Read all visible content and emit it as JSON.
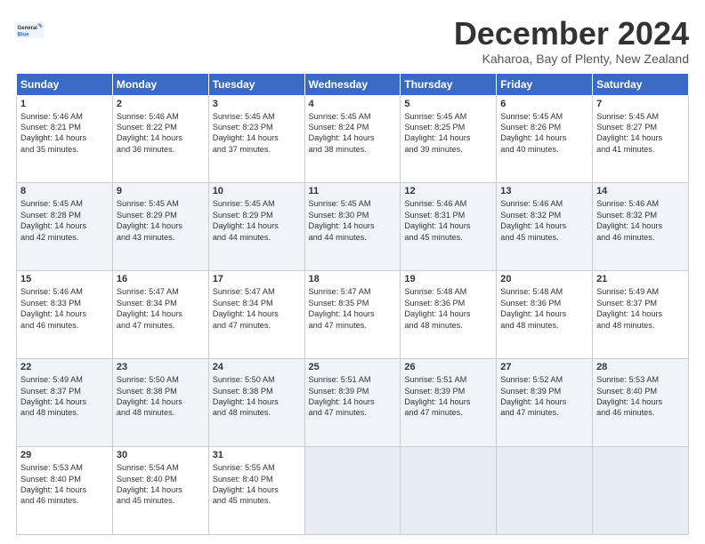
{
  "header": {
    "logo_line1": "General",
    "logo_line2": "Blue",
    "month": "December 2024",
    "location": "Kaharoa, Bay of Plenty, New Zealand"
  },
  "columns": [
    "Sunday",
    "Monday",
    "Tuesday",
    "Wednesday",
    "Thursday",
    "Friday",
    "Saturday"
  ],
  "weeks": [
    [
      {
        "day": "1",
        "lines": [
          "Sunrise: 5:46 AM",
          "Sunset: 8:21 PM",
          "Daylight: 14 hours",
          "and 35 minutes."
        ]
      },
      {
        "day": "2",
        "lines": [
          "Sunrise: 5:46 AM",
          "Sunset: 8:22 PM",
          "Daylight: 14 hours",
          "and 36 minutes."
        ]
      },
      {
        "day": "3",
        "lines": [
          "Sunrise: 5:45 AM",
          "Sunset: 8:23 PM",
          "Daylight: 14 hours",
          "and 37 minutes."
        ]
      },
      {
        "day": "4",
        "lines": [
          "Sunrise: 5:45 AM",
          "Sunset: 8:24 PM",
          "Daylight: 14 hours",
          "and 38 minutes."
        ]
      },
      {
        "day": "5",
        "lines": [
          "Sunrise: 5:45 AM",
          "Sunset: 8:25 PM",
          "Daylight: 14 hours",
          "and 39 minutes."
        ]
      },
      {
        "day": "6",
        "lines": [
          "Sunrise: 5:45 AM",
          "Sunset: 8:26 PM",
          "Daylight: 14 hours",
          "and 40 minutes."
        ]
      },
      {
        "day": "7",
        "lines": [
          "Sunrise: 5:45 AM",
          "Sunset: 8:27 PM",
          "Daylight: 14 hours",
          "and 41 minutes."
        ]
      }
    ],
    [
      {
        "day": "8",
        "lines": [
          "Sunrise: 5:45 AM",
          "Sunset: 8:28 PM",
          "Daylight: 14 hours",
          "and 42 minutes."
        ]
      },
      {
        "day": "9",
        "lines": [
          "Sunrise: 5:45 AM",
          "Sunset: 8:29 PM",
          "Daylight: 14 hours",
          "and 43 minutes."
        ]
      },
      {
        "day": "10",
        "lines": [
          "Sunrise: 5:45 AM",
          "Sunset: 8:29 PM",
          "Daylight: 14 hours",
          "and 44 minutes."
        ]
      },
      {
        "day": "11",
        "lines": [
          "Sunrise: 5:45 AM",
          "Sunset: 8:30 PM",
          "Daylight: 14 hours",
          "and 44 minutes."
        ]
      },
      {
        "day": "12",
        "lines": [
          "Sunrise: 5:46 AM",
          "Sunset: 8:31 PM",
          "Daylight: 14 hours",
          "and 45 minutes."
        ]
      },
      {
        "day": "13",
        "lines": [
          "Sunrise: 5:46 AM",
          "Sunset: 8:32 PM",
          "Daylight: 14 hours",
          "and 45 minutes."
        ]
      },
      {
        "day": "14",
        "lines": [
          "Sunrise: 5:46 AM",
          "Sunset: 8:32 PM",
          "Daylight: 14 hours",
          "and 46 minutes."
        ]
      }
    ],
    [
      {
        "day": "15",
        "lines": [
          "Sunrise: 5:46 AM",
          "Sunset: 8:33 PM",
          "Daylight: 14 hours",
          "and 46 minutes."
        ]
      },
      {
        "day": "16",
        "lines": [
          "Sunrise: 5:47 AM",
          "Sunset: 8:34 PM",
          "Daylight: 14 hours",
          "and 47 minutes."
        ]
      },
      {
        "day": "17",
        "lines": [
          "Sunrise: 5:47 AM",
          "Sunset: 8:34 PM",
          "Daylight: 14 hours",
          "and 47 minutes."
        ]
      },
      {
        "day": "18",
        "lines": [
          "Sunrise: 5:47 AM",
          "Sunset: 8:35 PM",
          "Daylight: 14 hours",
          "and 47 minutes."
        ]
      },
      {
        "day": "19",
        "lines": [
          "Sunrise: 5:48 AM",
          "Sunset: 8:36 PM",
          "Daylight: 14 hours",
          "and 48 minutes."
        ]
      },
      {
        "day": "20",
        "lines": [
          "Sunrise: 5:48 AM",
          "Sunset: 8:36 PM",
          "Daylight: 14 hours",
          "and 48 minutes."
        ]
      },
      {
        "day": "21",
        "lines": [
          "Sunrise: 5:49 AM",
          "Sunset: 8:37 PM",
          "Daylight: 14 hours",
          "and 48 minutes."
        ]
      }
    ],
    [
      {
        "day": "22",
        "lines": [
          "Sunrise: 5:49 AM",
          "Sunset: 8:37 PM",
          "Daylight: 14 hours",
          "and 48 minutes."
        ]
      },
      {
        "day": "23",
        "lines": [
          "Sunrise: 5:50 AM",
          "Sunset: 8:38 PM",
          "Daylight: 14 hours",
          "and 48 minutes."
        ]
      },
      {
        "day": "24",
        "lines": [
          "Sunrise: 5:50 AM",
          "Sunset: 8:38 PM",
          "Daylight: 14 hours",
          "and 48 minutes."
        ]
      },
      {
        "day": "25",
        "lines": [
          "Sunrise: 5:51 AM",
          "Sunset: 8:39 PM",
          "Daylight: 14 hours",
          "and 47 minutes."
        ]
      },
      {
        "day": "26",
        "lines": [
          "Sunrise: 5:51 AM",
          "Sunset: 8:39 PM",
          "Daylight: 14 hours",
          "and 47 minutes."
        ]
      },
      {
        "day": "27",
        "lines": [
          "Sunrise: 5:52 AM",
          "Sunset: 8:39 PM",
          "Daylight: 14 hours",
          "and 47 minutes."
        ]
      },
      {
        "day": "28",
        "lines": [
          "Sunrise: 5:53 AM",
          "Sunset: 8:40 PM",
          "Daylight: 14 hours",
          "and 46 minutes."
        ]
      }
    ],
    [
      {
        "day": "29",
        "lines": [
          "Sunrise: 5:53 AM",
          "Sunset: 8:40 PM",
          "Daylight: 14 hours",
          "and 46 minutes."
        ]
      },
      {
        "day": "30",
        "lines": [
          "Sunrise: 5:54 AM",
          "Sunset: 8:40 PM",
          "Daylight: 14 hours",
          "and 45 minutes."
        ]
      },
      {
        "day": "31",
        "lines": [
          "Sunrise: 5:55 AM",
          "Sunset: 8:40 PM",
          "Daylight: 14 hours",
          "and 45 minutes."
        ]
      },
      {
        "day": "",
        "lines": []
      },
      {
        "day": "",
        "lines": []
      },
      {
        "day": "",
        "lines": []
      },
      {
        "day": "",
        "lines": []
      }
    ]
  ]
}
